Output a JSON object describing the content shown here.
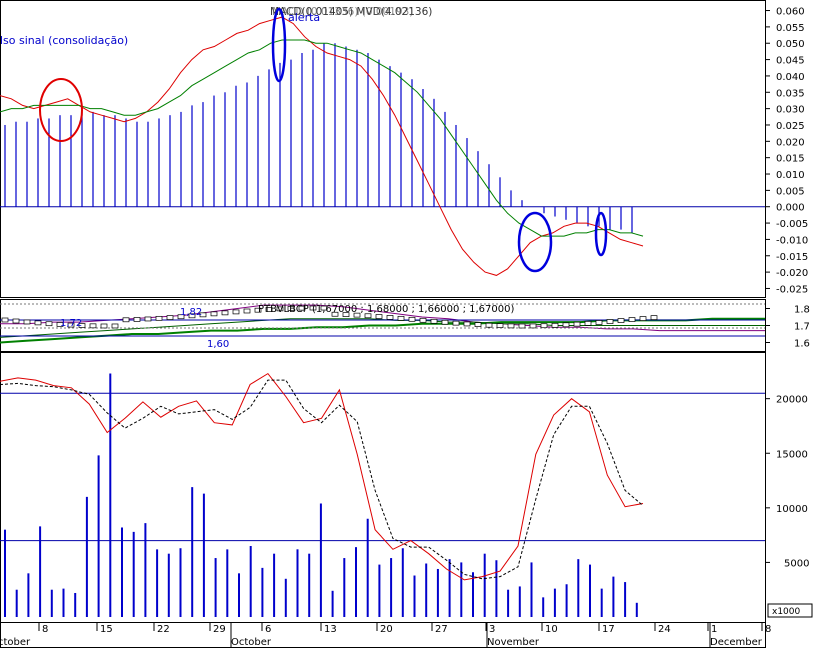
{
  "colors": {
    "background": "#ffffff",
    "frame": "#000000",
    "histogram": "#0000cc",
    "fast_line": "#dd0000",
    "slow_line": "#008000",
    "reference_line": "#0000aa",
    "annotation_red": "#e00000",
    "annotation_blue": "#0000dd",
    "label_text": "#0000cc"
  },
  "macd_panel": {
    "header": "MACD(0.01405) MVD(4.02136)",
    "header_overlap": "MACD  (0.01336) (0.00193)",
    "alert_label": "alerta",
    "signal_label": "lso sinal (consolidação)"
  },
  "price_panel": {
    "header": "PTBVLBCP (1,67000 ; 1,68000 ; 1,66000 ; 1,67000)",
    "level_high": "1,82",
    "level_mid": "1,72",
    "level_low": "1,60"
  },
  "volume_panel": {
    "scale_unit": "x1000"
  },
  "x_axis": {
    "date_ticks": [
      "8",
      "15",
      "22",
      "29",
      "6",
      "13",
      "20",
      "27",
      "3",
      "10",
      "17",
      "24",
      "1",
      "8"
    ],
    "month_labels": [
      "ctober",
      "October",
      "November",
      "December"
    ]
  },
  "chart_data": [
    {
      "type": "bar",
      "title": "MACD",
      "ylim": [
        -0.027,
        0.062
      ],
      "y_ticks": [
        "0.060",
        "0.055",
        "0.050",
        "0.045",
        "0.040",
        "0.035",
        "0.030",
        "0.025",
        "0.020",
        "0.015",
        "0.010",
        "0.005",
        "0.000",
        "-0.005",
        "-0.010",
        "-0.015",
        "-0.020",
        "-0.025"
      ],
      "horizontal_line": 0.0,
      "histogram": [
        0.025,
        0.026,
        0.026,
        0.027,
        0.027,
        0.028,
        0.028,
        0.029,
        0.029,
        0.028,
        0.028,
        0.027,
        0.026,
        0.026,
        0.027,
        0.028,
        0.029,
        0.031,
        0.032,
        0.034,
        0.035,
        0.037,
        0.038,
        0.04,
        0.042,
        0.044,
        0.045,
        0.047,
        0.048,
        0.05,
        0.05,
        0.049,
        0.048,
        0.047,
        0.045,
        0.043,
        0.041,
        0.039,
        0.036,
        0.033,
        0.029,
        0.025,
        0.021,
        0.017,
        0.013,
        0.009,
        0.005,
        0.002,
        0.0,
        -0.002,
        -0.003,
        -0.004,
        -0.005,
        -0.006,
        -0.006,
        -0.007,
        -0.007,
        -0.008
      ],
      "series": [
        {
          "values": [
            0.034,
            0.033,
            0.031,
            0.03,
            0.031,
            0.032,
            0.033,
            0.031,
            0.029,
            0.028,
            0.027,
            0.026,
            0.027,
            0.029,
            0.032,
            0.036,
            0.041,
            0.045,
            0.048,
            0.049,
            0.051,
            0.053,
            0.054,
            0.056,
            0.057,
            0.058,
            0.056,
            0.052,
            0.049,
            0.047,
            0.046,
            0.045,
            0.043,
            0.039,
            0.034,
            0.028,
            0.021,
            0.014,
            0.007,
            0.0,
            -0.007,
            -0.013,
            -0.017,
            -0.02,
            -0.021,
            -0.019,
            -0.015,
            -0.011,
            -0.009,
            -0.008,
            -0.006,
            -0.005,
            -0.005,
            -0.006,
            -0.008,
            -0.01,
            -0.011,
            -0.012
          ]
        },
        {
          "values": [
            0.029,
            0.03,
            0.03,
            0.031,
            0.031,
            0.031,
            0.031,
            0.031,
            0.03,
            0.03,
            0.029,
            0.028,
            0.028,
            0.029,
            0.03,
            0.032,
            0.034,
            0.037,
            0.039,
            0.041,
            0.043,
            0.045,
            0.047,
            0.048,
            0.05,
            0.051,
            0.051,
            0.051,
            0.05,
            0.05,
            0.049,
            0.048,
            0.047,
            0.045,
            0.043,
            0.041,
            0.038,
            0.035,
            0.031,
            0.027,
            0.022,
            0.017,
            0.012,
            0.007,
            0.002,
            -0.002,
            -0.005,
            -0.007,
            -0.009,
            -0.009,
            -0.009,
            -0.008,
            -0.008,
            -0.007,
            -0.007,
            -0.008,
            -0.008,
            -0.009
          ]
        }
      ]
    },
    {
      "type": "line",
      "title": "PTBVLBCP",
      "y_ticks": [
        "1.8",
        "1.7",
        "1.6"
      ],
      "ylim": [
        1.55,
        1.85
      ],
      "series": [
        {
          "values": [
            1.71,
            1.71,
            1.72,
            1.72,
            1.73,
            1.74,
            1.75,
            1.76,
            1.78,
            1.8,
            1.82,
            1.82,
            1.82,
            1.81,
            1.79,
            1.77,
            1.75,
            1.74,
            1.72,
            1.71,
            1.7,
            1.69,
            1.69,
            1.68,
            1.68,
            1.67,
            1.67,
            1.67,
            1.67,
            1.67
          ]
        },
        {
          "values": [
            1.6,
            1.61,
            1.62,
            1.63,
            1.64,
            1.65,
            1.65,
            1.66,
            1.67,
            1.67,
            1.68,
            1.68,
            1.69,
            1.69,
            1.7,
            1.7,
            1.71,
            1.71,
            1.71,
            1.72,
            1.72,
            1.72,
            1.72,
            1.73,
            1.73,
            1.73,
            1.73,
            1.74,
            1.74,
            1.74
          ]
        },
        {
          "values": [
            1.63,
            1.64,
            1.65,
            1.66,
            1.67,
            1.68,
            1.69,
            1.7,
            1.71,
            1.72,
            1.73,
            1.74,
            1.74,
            1.74,
            1.74,
            1.73,
            1.73,
            1.72,
            1.72,
            1.71,
            1.71,
            1.7,
            1.7,
            1.7,
            1.7,
            1.7,
            1.7,
            1.7,
            1.7,
            1.7
          ]
        }
      ]
    },
    {
      "type": "bar",
      "title": "Volume",
      "ylim": [
        0,
        24000
      ],
      "y_ticks": [
        "20000",
        "15000",
        "10000",
        "5000"
      ],
      "horizontal_lines": [
        20500,
        7000
      ],
      "volume_bars": [
        8000,
        2500,
        4000,
        8300,
        2500,
        2600,
        2200,
        11000,
        14800,
        22300,
        8200,
        7800,
        8600,
        6200,
        5800,
        6300,
        11900,
        11300,
        5400,
        6200,
        4000,
        6500,
        4500,
        5800,
        3500,
        6200,
        5800,
        10400,
        2400,
        5400,
        6400,
        9000,
        4800,
        5400,
        6300,
        3800,
        4900,
        4400,
        5300,
        5000,
        4100,
        5800,
        5200,
        2500,
        2800,
        5000,
        1800,
        2600,
        3000,
        5300,
        4800,
        2600,
        3700,
        3200,
        1300
      ],
      "series": [
        {
          "values": [
            21600,
            21900,
            21700,
            21200,
            21000,
            19500,
            16900,
            18200,
            19700,
            18300,
            19300,
            19800,
            17800,
            17600,
            21300,
            22300,
            20200,
            17800,
            18200,
            20800,
            14900,
            8000,
            6200,
            7000,
            5800,
            4400,
            3400,
            3700,
            4200,
            6500,
            14900,
            18500,
            20000,
            18800,
            13000,
            10100,
            10400
          ]
        },
        {
          "values": [
            21300,
            21400,
            21200,
            21100,
            20800,
            20400,
            18700,
            17300,
            18200,
            19300,
            18600,
            18800,
            19000,
            18100,
            19200,
            21700,
            21700,
            19100,
            17800,
            19400,
            17900,
            11600,
            7200,
            6400,
            6400,
            5200,
            3900,
            3500,
            3700,
            4600,
            10800,
            16700,
            19300,
            19300,
            15900,
            11600,
            10200
          ]
        }
      ]
    }
  ]
}
